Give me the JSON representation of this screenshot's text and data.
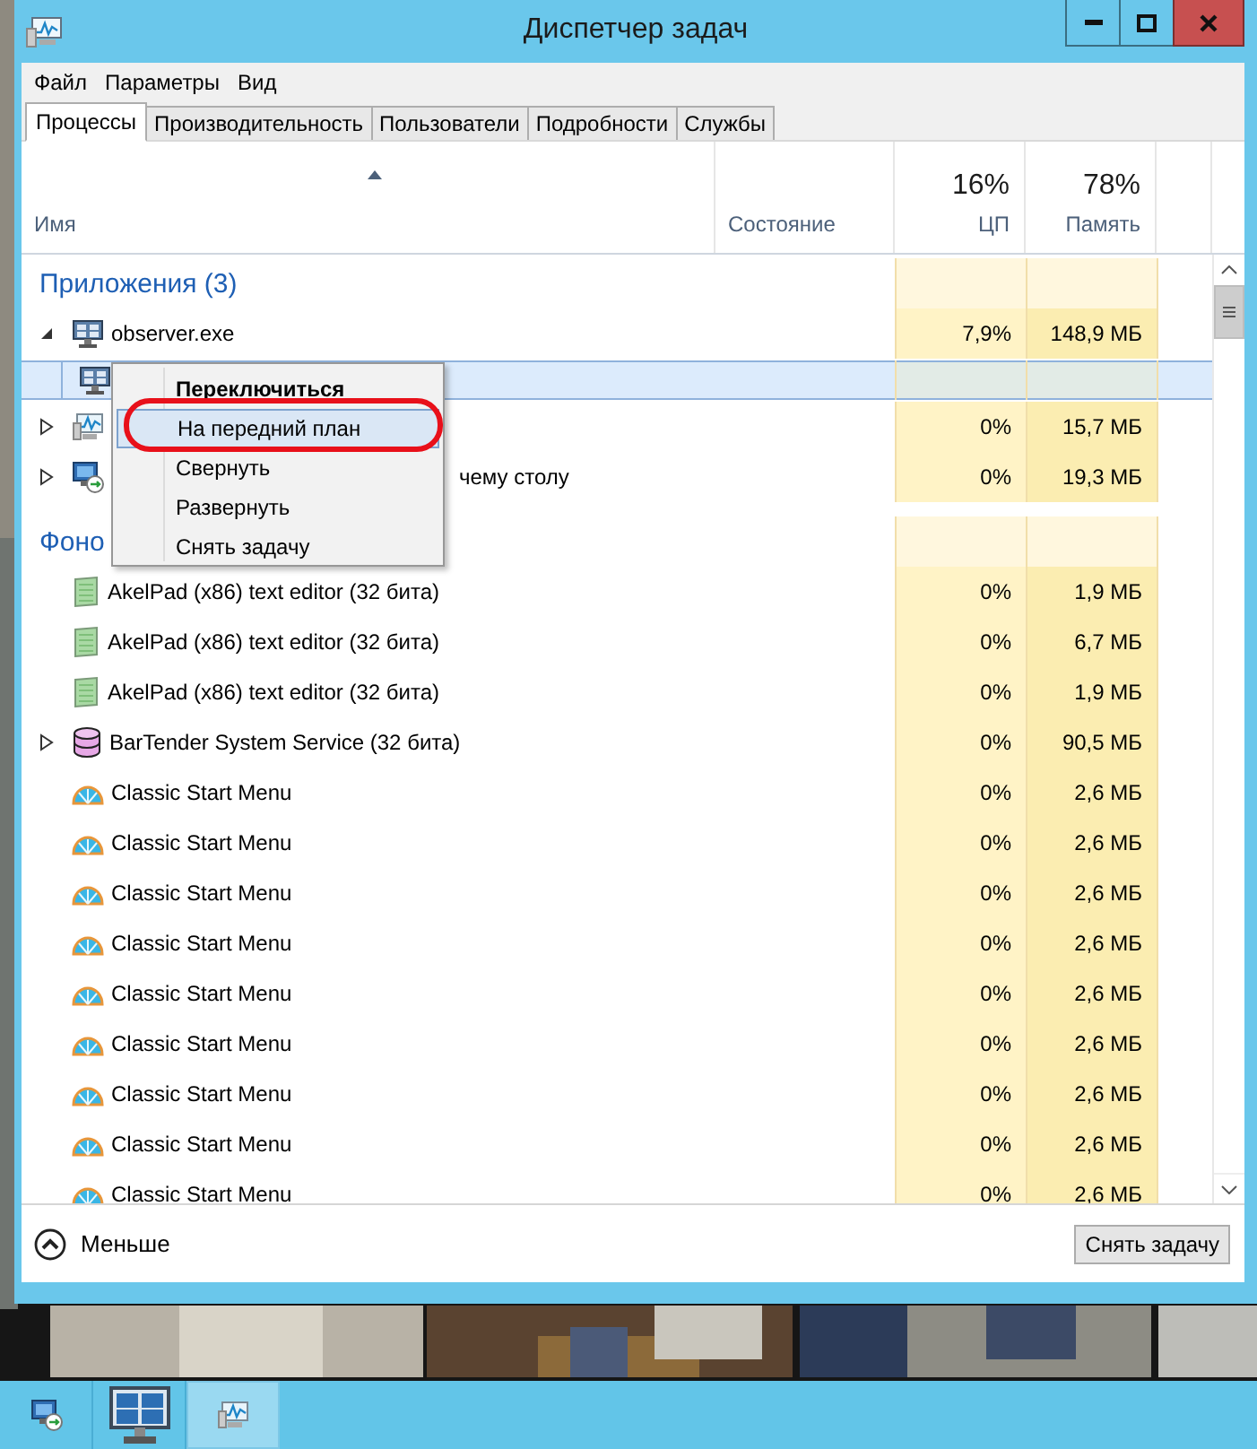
{
  "window": {
    "title": "Диспетчер задач"
  },
  "menu": [
    "Файл",
    "Параметры",
    "Вид"
  ],
  "tabs": [
    {
      "label": "Процессы",
      "selected": true
    },
    {
      "label": "Производительность",
      "selected": false
    },
    {
      "label": "Пользователи",
      "selected": false
    },
    {
      "label": "Подробности",
      "selected": false
    },
    {
      "label": "Службы",
      "selected": false
    }
  ],
  "columns": [
    {
      "name": "Имя",
      "sorted": true
    },
    {
      "name": "Состояние",
      "sorted": false
    },
    {
      "total": "16%",
      "name": "ЦП",
      "sorted": false
    },
    {
      "total": "78%",
      "name": "Память",
      "sorted": false
    }
  ],
  "rows": [
    {
      "kind": "group",
      "name": "Приложения (3)"
    },
    {
      "kind": "monitor",
      "expanded": true,
      "name": "observer.exe",
      "cpu": "7,9%",
      "memory": "148,9 МБ",
      "selected": false
    },
    {
      "kind": "child",
      "selected": true
    },
    {
      "kind": "perf",
      "expanded": false,
      "cpu": "0%",
      "memory": "15,7 МБ",
      "selected": false
    },
    {
      "kind": "remote",
      "expanded": false,
      "name": "чему столу",
      "covered": true,
      "cpu": "0%",
      "memory": "19,3 МБ",
      "selected": false
    },
    {
      "kind": "group",
      "name": "Фоно"
    },
    {
      "kind": "notepad",
      "name": "AkelPad (x86) text editor (32 бита)",
      "cpu": "0%",
      "memory": "1,9 МБ",
      "selected": false
    },
    {
      "kind": "notepad",
      "name": "AkelPad (x86) text editor (32 бита)",
      "cpu": "0%",
      "memory": "6,7 МБ",
      "selected": false
    },
    {
      "kind": "notepad",
      "name": "AkelPad (x86) text editor (32 бита)",
      "cpu": "0%",
      "memory": "1,9 МБ",
      "selected": false
    },
    {
      "kind": "database",
      "expanded": false,
      "name": "BarTender System Service (32 бита)",
      "cpu": "0%",
      "memory": "90,5 МБ",
      "selected": false
    },
    {
      "kind": "shell",
      "name": "Classic Start Menu",
      "cpu": "0%",
      "memory": "2,6 МБ",
      "selected": false
    },
    {
      "kind": "shell",
      "name": "Classic Start Menu",
      "cpu": "0%",
      "memory": "2,6 МБ",
      "selected": false
    },
    {
      "kind": "shell",
      "name": "Classic Start Menu",
      "cpu": "0%",
      "memory": "2,6 МБ",
      "selected": false
    },
    {
      "kind": "shell",
      "name": "Classic Start Menu",
      "cpu": "0%",
      "memory": "2,6 МБ",
      "selected": false
    },
    {
      "kind": "shell",
      "name": "Classic Start Menu",
      "cpu": "0%",
      "memory": "2,6 МБ",
      "selected": false
    },
    {
      "kind": "shell",
      "name": "Classic Start Menu",
      "cpu": "0%",
      "memory": "2,6 МБ",
      "selected": false
    },
    {
      "kind": "shell",
      "name": "Classic Start Menu",
      "cpu": "0%",
      "memory": "2,6 МБ",
      "selected": false
    },
    {
      "kind": "shell",
      "name": "Classic Start Menu",
      "cpu": "0%",
      "memory": "2,6 МБ",
      "selected": false
    },
    {
      "kind": "shell",
      "name": "Classic Start Menu",
      "cpu": "0%",
      "memory": "2,6 МБ",
      "selected": false
    }
  ],
  "context_menu": {
    "items": [
      {
        "label": "Переключиться",
        "default": true,
        "highlighted": false,
        "circled": false
      },
      {
        "label": "На передний план",
        "default": false,
        "highlighted": true,
        "circled": true
      },
      {
        "label": "Свернуть",
        "default": false,
        "highlighted": false,
        "circled": false
      },
      {
        "label": "Развернуть",
        "default": false,
        "highlighted": false,
        "circled": false
      },
      {
        "label": "Снять задачу",
        "default": false,
        "highlighted": false,
        "circled": false
      }
    ]
  },
  "footer": {
    "toggle": "Меньше",
    "button": "Снять задачу"
  },
  "taskbar": [
    {
      "kind": "remote",
      "selected": false
    },
    {
      "kind": "cameras",
      "selected": false
    },
    {
      "kind": "perf",
      "selected": true
    }
  ]
}
